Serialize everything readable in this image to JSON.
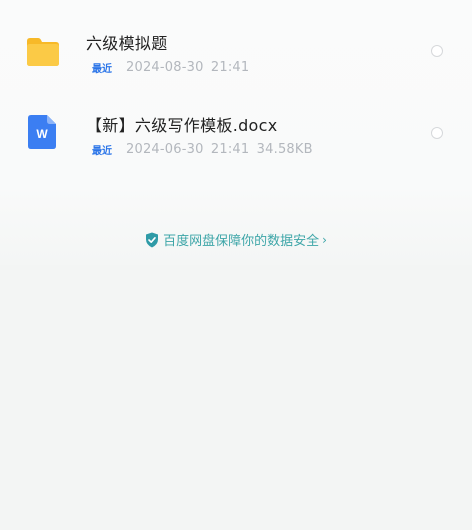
{
  "files": [
    {
      "name": "六级模拟题",
      "badge": "最近",
      "meta": "2024-08-30 21:41",
      "type": "folder"
    },
    {
      "name": "【新】六级写作模板.docx",
      "badge": "最近",
      "meta": "2024-06-30 21:41 34.58KB",
      "type": "docx",
      "icon_letter": "W"
    }
  ],
  "footer": {
    "security_text": "百度网盘保障你的数据安全",
    "chevron": "›"
  },
  "colors": {
    "accent_blue": "#2a74e8",
    "folder_yellow": "#f9c63c",
    "security_teal": "#3ea6a8"
  }
}
